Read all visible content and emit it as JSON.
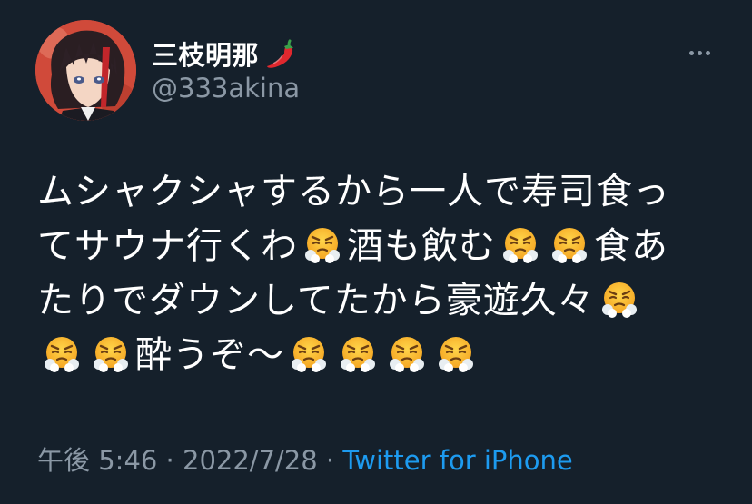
{
  "user": {
    "display_name": "三枝明那",
    "name_emoji": "hot-pepper-icon",
    "handle": "@333akina",
    "avatar": "avatar"
  },
  "tweet": {
    "lines": [
      [
        {
          "t": "text",
          "v": "ムシャクシャするから一人で寿司食っ"
        }
      ],
      [
        {
          "t": "text",
          "v": "てサウナ行くわ"
        },
        {
          "t": "emoji"
        },
        {
          "t": "text",
          "v": "酒も飲む"
        },
        {
          "t": "emoji"
        },
        {
          "t": "emoji"
        },
        {
          "t": "text",
          "v": "食あ"
        }
      ],
      [
        {
          "t": "text",
          "v": "たりでダウンしてたから豪遊久々"
        },
        {
          "t": "emoji"
        }
      ],
      [
        {
          "t": "emoji"
        },
        {
          "t": "emoji"
        },
        {
          "t": "text",
          "v": "酔うぞ〜"
        },
        {
          "t": "emoji"
        },
        {
          "t": "emoji"
        },
        {
          "t": "emoji"
        },
        {
          "t": "emoji"
        }
      ]
    ],
    "emoji_name": "face-with-steam-from-nose-icon"
  },
  "meta": {
    "time": "午後 5:46",
    "separator": " · ",
    "date": "2022/7/28",
    "source": "Twitter for iPhone"
  },
  "colors": {
    "background": "#15202b",
    "text": "#ffffff",
    "secondary": "#8b98a5",
    "link": "#1d9bf0",
    "divider": "#38444d"
  }
}
